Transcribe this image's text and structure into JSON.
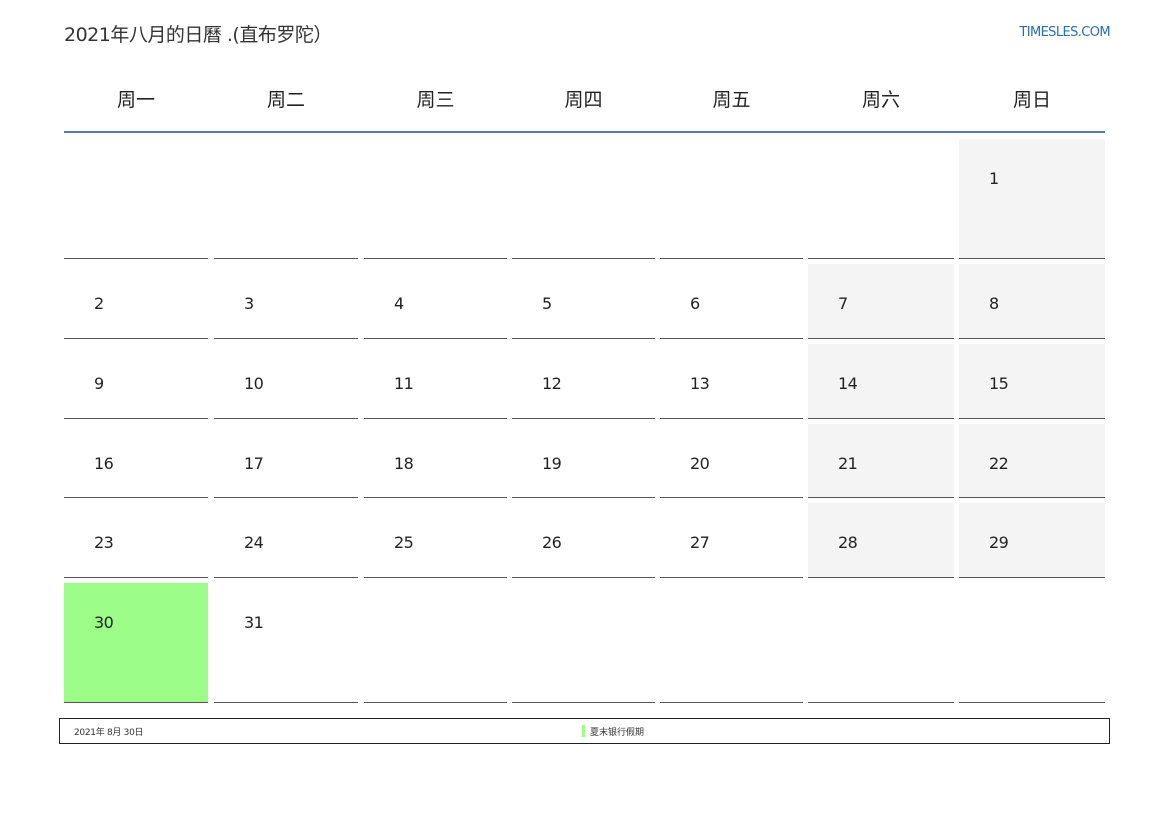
{
  "header": {
    "title": "2021年八月的日曆 .(直布罗陀）",
    "brand": "TIMESLES.COM"
  },
  "weekdays": [
    "周一",
    "周二",
    "周三",
    "周四",
    "周五",
    "周六",
    "周日"
  ],
  "weeks": [
    [
      "",
      "",
      "",
      "",
      "",
      "",
      "1"
    ],
    [
      "2",
      "3",
      "4",
      "5",
      "6",
      "7",
      "8"
    ],
    [
      "9",
      "10",
      "11",
      "12",
      "13",
      "14",
      "15"
    ],
    [
      "16",
      "17",
      "18",
      "19",
      "20",
      "21",
      "22"
    ],
    [
      "23",
      "24",
      "25",
      "26",
      "27",
      "28",
      "29"
    ],
    [
      "30",
      "31",
      "",
      "",
      "",
      "",
      ""
    ]
  ],
  "holidays": [
    {
      "date": "2021年 8月 30日",
      "name": "夏末银行假期",
      "day": "30"
    }
  ],
  "colors": {
    "holiday": "#9cfd88",
    "weekend": "#f4f4f4",
    "header_line": "#5b7aa0",
    "brand": "#2b6cb0"
  }
}
